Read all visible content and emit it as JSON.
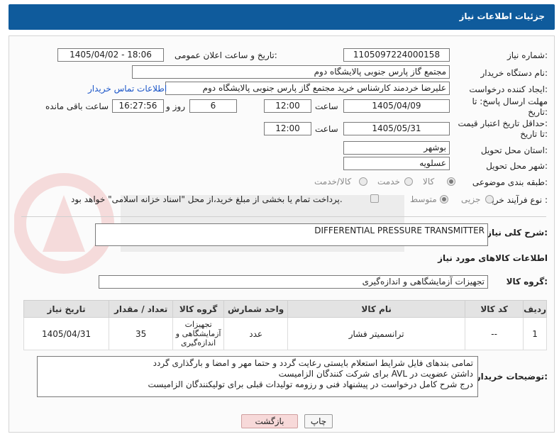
{
  "header": {
    "title": "جزئیات اطلاعات نیاز"
  },
  "form": {
    "need_number_label": "شماره نیاز:",
    "need_number": "1105097224000158",
    "announce_label": "تاریخ و ساعت اعلان عمومی:",
    "announce_value": "1405/04/02 - 18:06",
    "buyer_org_label": "نام دستگاه خریدار:",
    "buyer_org": "مجتمع گاز پارس جنوبی  پالایشگاه دوم",
    "creator_label": "ایجاد کننده درخواست:",
    "creator": "علیرضا خردمند کارشناس خرید مجتمع گاز پارس جنوبی  پالایشگاه دوم",
    "contact_link": "اطلاعات تماس خریدار",
    "reply_deadline_label_1": "مهلت ارسال پاسخ: تا",
    "reply_deadline_label_2": "تاریخ:",
    "reply_date": "1405/04/09",
    "time_label": "ساعت",
    "reply_time": "12:00",
    "days_value": "6",
    "days_label": "روز و",
    "remaining_time": "16:27:56",
    "remaining_label": "ساعت باقی مانده",
    "price_deadline_label_1": "حداقل تاریخ اعتبار قیمت:",
    "price_deadline_label_2": "تا تاریخ:",
    "price_date": "1405/05/31",
    "price_time_label": "ساعت",
    "price_time": "12:00",
    "province_label": "استان محل تحویل:",
    "province": "بوشهر",
    "city_label": "شهر محل تحویل:",
    "city": "عسلویه",
    "category_label": "طبقه بندی موضوعی:",
    "category_options": [
      "کالا",
      "خدمت",
      "کالا/خدمت"
    ],
    "process_label": "نوع فرآیند خرید :",
    "process_options": [
      "جزیی",
      "متوسط"
    ],
    "payment_note": "پرداخت تمام یا بخشی از مبلغ خرید،از محل \"اسناد خزانه اسلامی\" خواهد بود."
  },
  "description": {
    "label": "شرح کلی نیاز:",
    "value": "DIFFERENTIAL PRESSURE TRANSMITTER"
  },
  "goods_info_title": "اطلاعات کالاهای مورد نیاز",
  "goods_group": {
    "label": "گروه کالا:",
    "value": "تجهیزات آزمایشگاهی و اندازه‌گیری"
  },
  "table": {
    "headers": [
      "ردیف",
      "کد کالا",
      "نام کالا",
      "واحد شمارش",
      "گروه کالا",
      "تعداد / مقدار",
      "تاریخ نیاز"
    ],
    "rows": [
      [
        "1",
        "--",
        "ترانسمیتر فشار",
        "عدد",
        "تجهیزات آزمایشگاهی و اندازه‌گیری",
        "35",
        "1405/04/31"
      ]
    ]
  },
  "buyer_notes": {
    "label": "توضیحات خریدار:",
    "lines": [
      "تمامی بندهای فایل شرایط استعلام بایستی رعایت گردد و حتما مهر و امضا و بارگذاری گردد",
      "داشتن عضویت در AVL برای شرکت کنندگان الزامیست",
      "درج شرح کامل درخواست در پیشنهاد فنی و رزومه تولیدات قبلی برای تولیکنندگان الزامیست"
    ]
  },
  "buttons": {
    "print": "چاپ",
    "back": "بازگشت"
  },
  "colors": {
    "header_bg": "#0f5b9c",
    "link": "#1a55c8",
    "back_btn": "#f7d9d9"
  }
}
